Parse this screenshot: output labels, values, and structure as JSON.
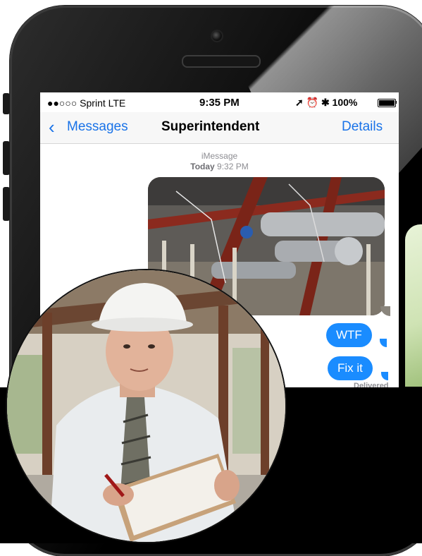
{
  "status_bar": {
    "carrier": "●●○○○ Sprint  LTE",
    "time": "9:35 PM",
    "right": "➚ ⏰ ✱  100%",
    "battery_level": 1.0
  },
  "nav": {
    "back_label": "Messages",
    "title": "Superintendent",
    "details_label": "Details"
  },
  "thread": {
    "service": "iMessage",
    "day": "Today",
    "time": "9:32 PM"
  },
  "messages": [
    {
      "text": "WTF"
    },
    {
      "text": "Fix it"
    }
  ],
  "delivery_status": "Delivered",
  "colors": {
    "ios_blue": "#1a73e8",
    "bubble_blue": "#1a8cff",
    "phone_black": "#000000"
  },
  "icons": [
    "chevron-left-icon",
    "battery-icon",
    "alarm-icon",
    "location-icon",
    "bluetooth-icon"
  ]
}
